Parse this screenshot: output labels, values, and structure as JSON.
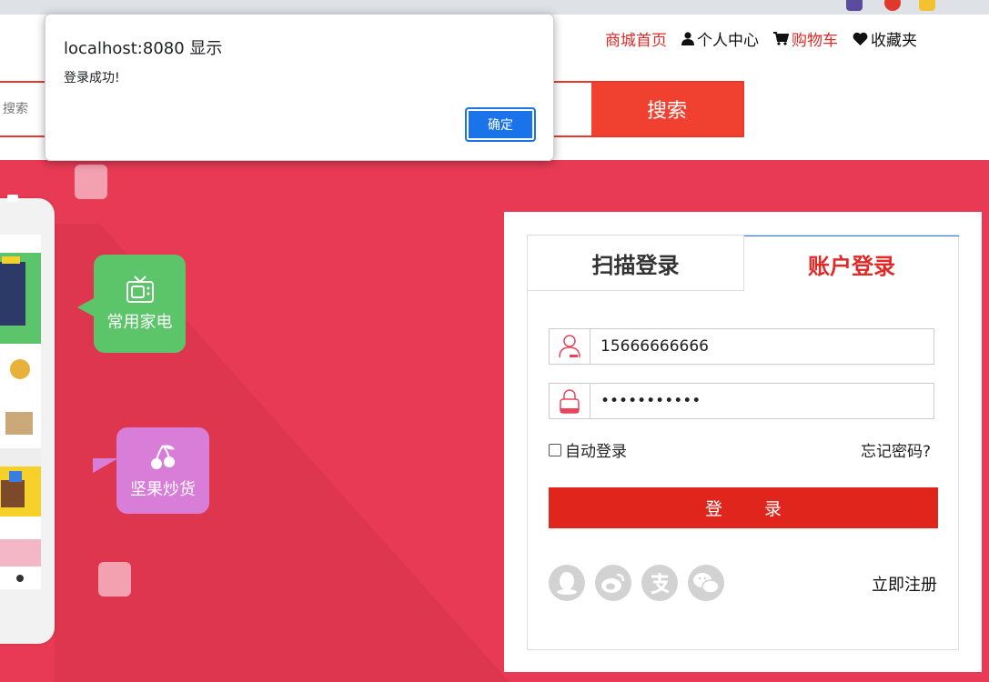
{
  "topnav": {
    "home": "商城首页",
    "profile": "个人中心",
    "cart": "购物车",
    "favorites": "收藏夹"
  },
  "search": {
    "placeholder": "搜索",
    "button": "搜索"
  },
  "banner": {
    "appliances": "常用家电",
    "nuts": "坚果炒货"
  },
  "login": {
    "tab_scan": "扫描登录",
    "tab_account": "账户登录",
    "username": "15666666666",
    "password_mask": "•••••••••••",
    "remember": "自动登录",
    "forgot": "忘记密码?",
    "submit": "登 录",
    "register": "立即注册"
  },
  "dialog": {
    "title": "localhost:8080 显示",
    "message": "登录成功!",
    "ok": "确定"
  },
  "colors": {
    "accent": "#e02a28",
    "banner": "#e83a55",
    "dialog_button": "#1a73e8"
  }
}
